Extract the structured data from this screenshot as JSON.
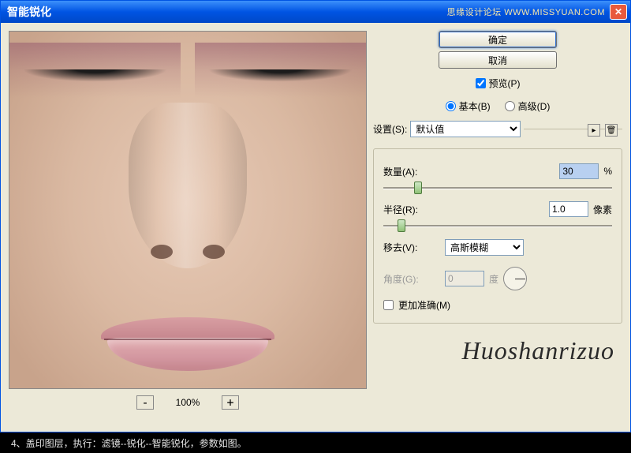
{
  "title": "智能锐化",
  "watermark_header": "思缘设计论坛  WWW.MISSYUAN.COM",
  "buttons": {
    "ok": "确定",
    "cancel": "取消"
  },
  "preview": {
    "label": "预览(P)",
    "checked": true
  },
  "mode": {
    "basic": "基本(B)",
    "advanced": "高级(D)",
    "selected": "basic"
  },
  "settings": {
    "label": "设置(S):",
    "select_value": "默认值"
  },
  "amount": {
    "label": "数量(A):",
    "value": "30",
    "unit": "%",
    "pos": 15
  },
  "radius": {
    "label": "半径(R):",
    "value": "1.0",
    "unit": "像素",
    "pos": 8
  },
  "remove": {
    "label": "移去(V):",
    "value": "高斯模糊"
  },
  "angle": {
    "label": "角度(G):",
    "value": "0",
    "unit": "度"
  },
  "accurate": {
    "label": "更加准确(M)",
    "checked": false
  },
  "zoom": {
    "value": "100%"
  },
  "signature": "Huoshanrizuo",
  "footer": "4、盖印图层，执行：滤镜--锐化--智能锐化，参数如图。"
}
